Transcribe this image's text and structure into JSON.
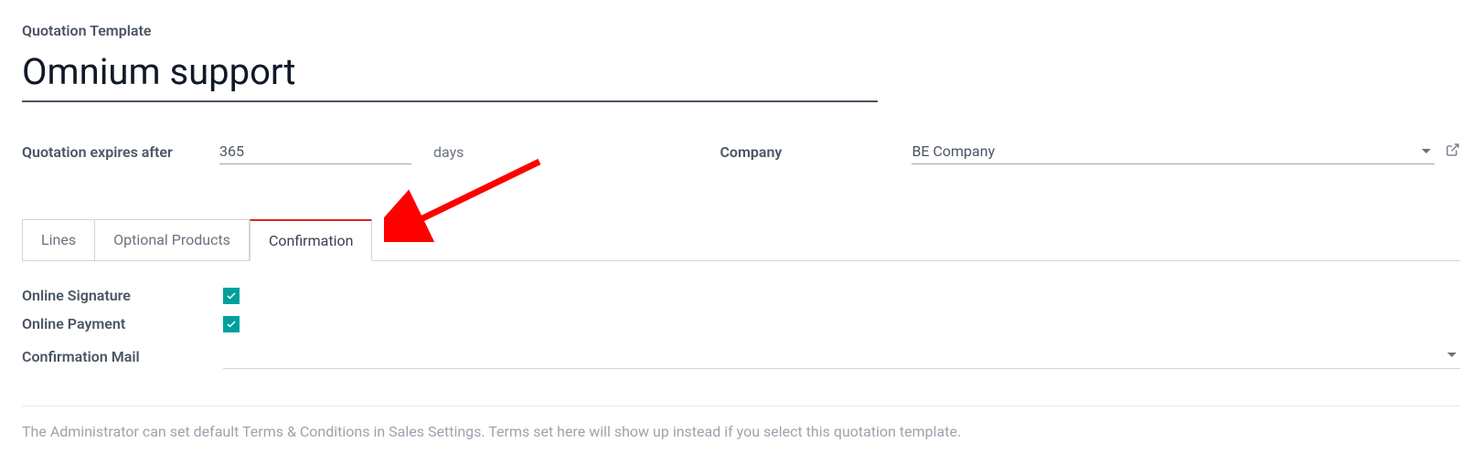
{
  "header": {
    "form_label": "Quotation Template",
    "title": "Omnium support"
  },
  "fields": {
    "expires_label": "Quotation expires after",
    "expires_value": "365",
    "expires_unit": "days",
    "company_label": "Company",
    "company_value": "BE Company"
  },
  "tabs": {
    "lines": "Lines",
    "optional": "Optional Products",
    "confirmation": "Confirmation"
  },
  "confirmation": {
    "signature_label": "Online Signature",
    "payment_label": "Online Payment",
    "mail_label": "Confirmation Mail"
  },
  "terms": {
    "placeholder": "The Administrator can set default Terms & Conditions in Sales Settings. Terms set here will show up instead if you select this quotation template."
  },
  "annotation": {
    "arrow_color": "#ff0000"
  }
}
